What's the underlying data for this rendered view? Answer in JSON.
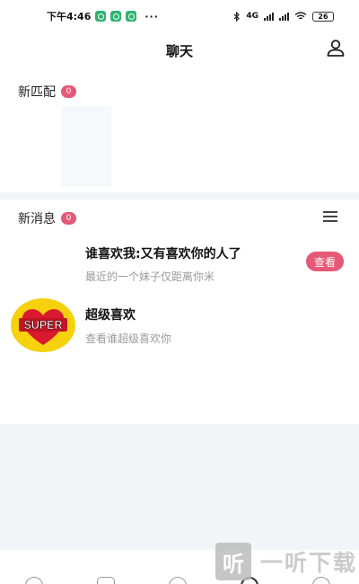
{
  "status_bar": {
    "time": "下午4:46",
    "dots": "···",
    "network": "4G",
    "battery": "26"
  },
  "header": {
    "title": "聊天"
  },
  "new_matches": {
    "label": "新匹配",
    "count": "0"
  },
  "messages": {
    "label": "新消息",
    "count": "0",
    "items": [
      {
        "title": "谁喜欢我:又有喜欢你的人了",
        "subtitle": "最近的一个妹子仅距离你米",
        "action": "查看"
      },
      {
        "title": "超级喜欢",
        "subtitle": "查看谁超级喜欢你",
        "avatar_text": "SUPER"
      }
    ]
  },
  "watermark": {
    "logo": "听",
    "text": "一听下载"
  },
  "colors": {
    "accent": "#e45a76",
    "super_yellow": "#f5d20d",
    "heart_red": "#d9192e",
    "notif_green": "#2fb36f"
  }
}
